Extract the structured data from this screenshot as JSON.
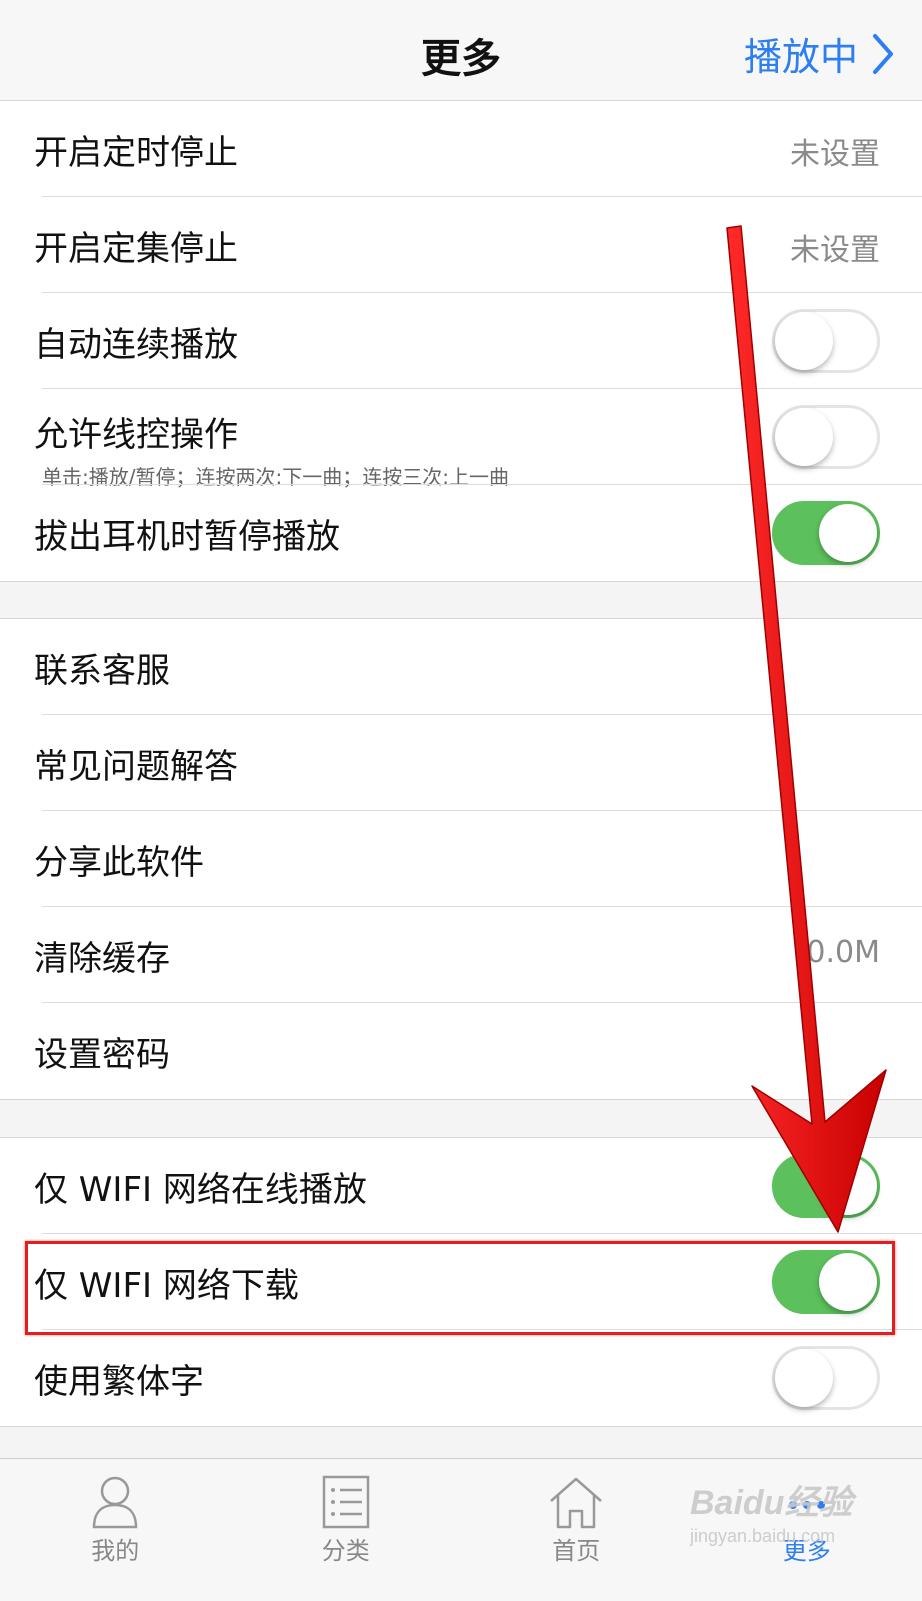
{
  "navbar": {
    "title": "更多",
    "right_label": "播放中",
    "colors": {
      "accent": "#2d7ff0"
    }
  },
  "group1": [
    {
      "label": "开启定时停止",
      "value": "未设置"
    },
    {
      "label": "开启定集停止",
      "value": "未设置"
    },
    {
      "label": "自动连续播放",
      "toggle": "off"
    },
    {
      "label": "允许线控操作",
      "sub": "单击:播放/暂停；连按两次:下一曲；连按三次:上一曲",
      "toggle": "off"
    },
    {
      "label": "拔出耳机时暂停播放",
      "toggle": "on"
    }
  ],
  "group2": [
    {
      "label": "联系客服"
    },
    {
      "label": "常见问题解答"
    },
    {
      "label": "分享此软件"
    },
    {
      "label": "清除缓存",
      "value": "0.0M"
    },
    {
      "label": "设置密码"
    }
  ],
  "group3": [
    {
      "label": "仅 WIFI 网络在线播放",
      "toggle": "on"
    },
    {
      "label": "仅 WIFI 网络下载",
      "toggle": "on"
    },
    {
      "label": "使用繁体字",
      "toggle": "off"
    }
  ],
  "tabbar": {
    "items": [
      {
        "label": "我的",
        "icon": "person-icon"
      },
      {
        "label": "分类",
        "icon": "list-icon"
      },
      {
        "label": "首页",
        "icon": "home-icon"
      },
      {
        "label": "更多",
        "icon": "more-icon",
        "active": true
      }
    ]
  },
  "watermark": {
    "main": "Baidu经验",
    "sub": "jingyan.baidu.com"
  },
  "annotation": {
    "arrow_color": "#e01010",
    "box_color": "#e02020"
  },
  "toggle_colors": {
    "on": "#5cc05c",
    "off": "#ffffff"
  }
}
